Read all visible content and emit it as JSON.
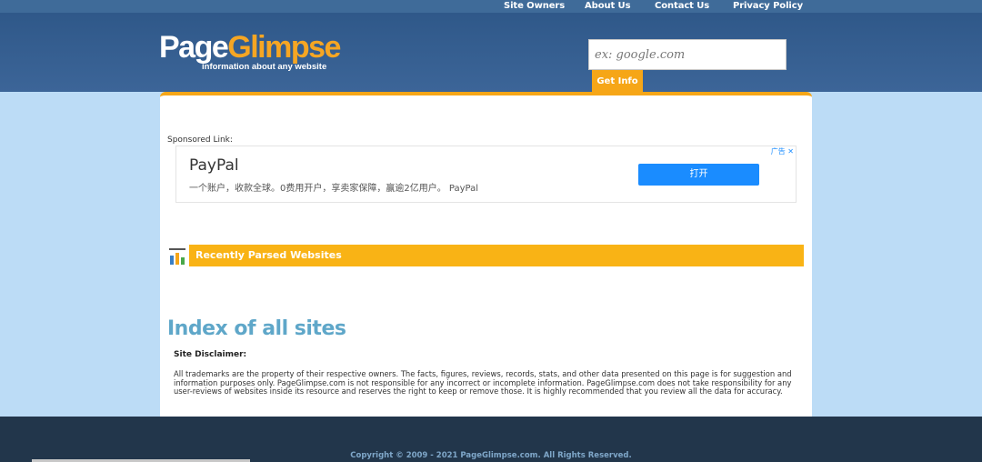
{
  "nav": {
    "items": [
      {
        "label": "Site Owners"
      },
      {
        "label": "About Us"
      },
      {
        "label": "Contact Us"
      },
      {
        "label": "Privacy Policy"
      }
    ]
  },
  "logo": {
    "part1": "Page",
    "part2": "Glimpse",
    "tagline": "information about any website"
  },
  "search": {
    "placeholder": "ex: google.com",
    "value": "",
    "button_label": "Get Info"
  },
  "ad": {
    "sponsored_label": "Sponsored Link:",
    "title": "PayPal",
    "description": "一个账户，收款全球。0费用开户，享卖家保障，赢逾2亿用户。 PayPal",
    "button_label": "打开",
    "adchoices": "广告 ✕"
  },
  "recent": {
    "label": "Recently Parsed Websites"
  },
  "index": {
    "title": "Index of all sites",
    "disclaimer_title": "Site Disclaimer:",
    "disclaimer_text": "All trademarks are the property of their respective owners. The facts, figures, reviews, records, stats, and other data presented on this page is for suggestion and information purposes only. PageGlimpse.com is not responsible for any incorrect or incomplete information. PageGlimpse.com does not take responsibility for any user-reviews of websites inside its resource and reserves the right to keep or remove those. It is highly recommended that you review all the data for accuracy."
  },
  "footer": {
    "copyright": "Copyright © 2009 - 2021 PageGlimpse.com. All Rights Reserved."
  },
  "colors": {
    "accent": "#f6a617",
    "header": "#2f5889",
    "page_bg": "#bcdcf6",
    "footer": "#22364b",
    "index_title": "#5fa7c9"
  }
}
